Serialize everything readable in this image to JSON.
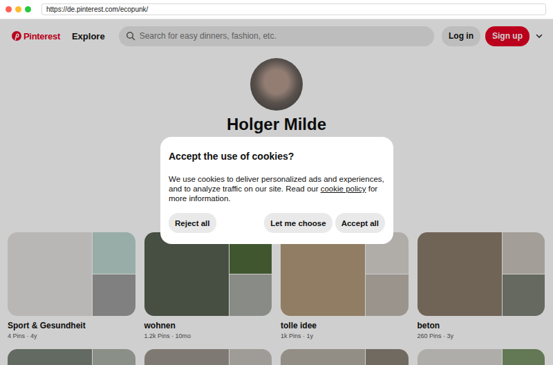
{
  "window": {
    "url": "https://de.pinterest.com/ecopunk/"
  },
  "header": {
    "logo": "Pinterest",
    "nav": "Explore",
    "search": {
      "placeholder": "Search for easy dinners, fashion, etc."
    },
    "login": "Log in",
    "signup": "Sign up"
  },
  "profile": {
    "name": "Holger Milde"
  },
  "cookie_dialog": {
    "title": "Accept the use of cookies?",
    "text_before": "We use cookies to deliver personalized ads and experiences, and to analyze traffic on our site. Read our ",
    "link": "cookie policy",
    "text_after": " for more information.",
    "buttons": [
      "Reject all",
      "Let me choose",
      "Accept all"
    ]
  },
  "boards": [
    {
      "title": "Sport & Gesundheit",
      "meta": "4 Pins · 4y"
    },
    {
      "title": "wohnen",
      "meta": "1.2k Pins · 10mo"
    },
    {
      "title": "tolle idee",
      "meta": "1k Pins · 1y"
    },
    {
      "title": "beton",
      "meta": "260 Pins · 3y"
    }
  ]
}
